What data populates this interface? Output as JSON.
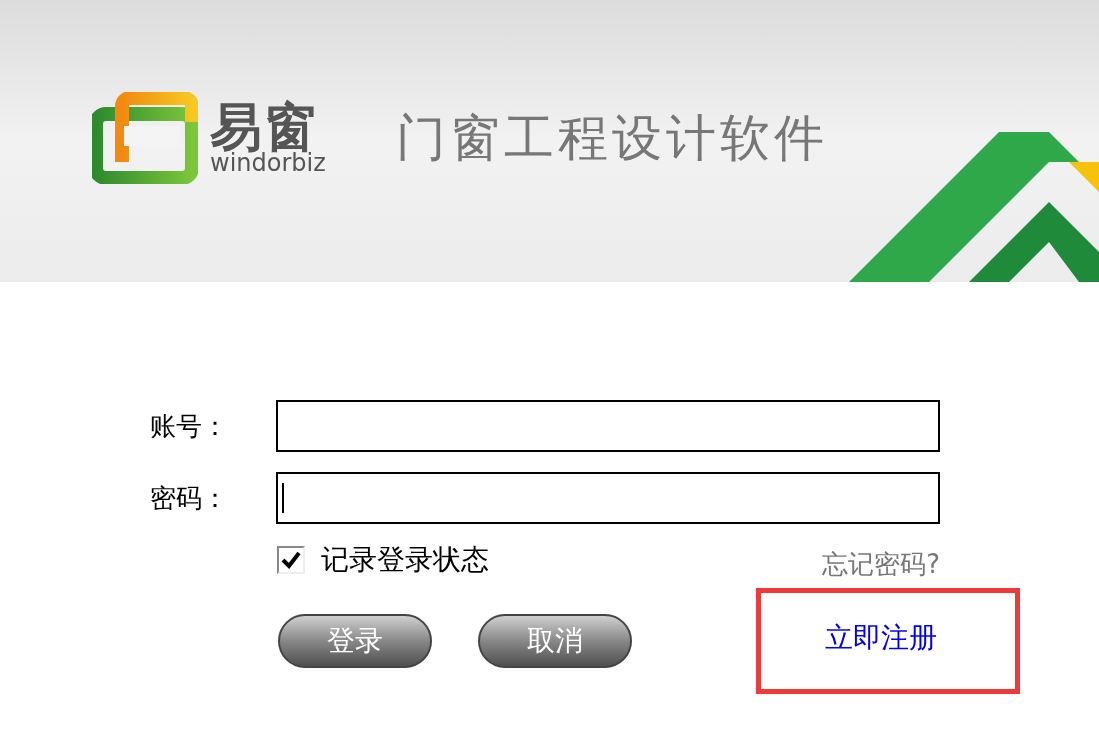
{
  "header": {
    "logo_name": "易窗",
    "logo_sub": "windorbiz",
    "tagline": "门窗工程设计软件"
  },
  "form": {
    "fields": [
      {
        "label": "账号：",
        "focused": false
      },
      {
        "label": "密码：",
        "focused": true
      }
    ],
    "remember": {
      "label": "记录登录状态",
      "checked": true
    },
    "forgot": "忘记密码?",
    "buttons": [
      "登录",
      "取消"
    ],
    "register": {
      "label": "立即注册",
      "highlighted": true
    }
  }
}
